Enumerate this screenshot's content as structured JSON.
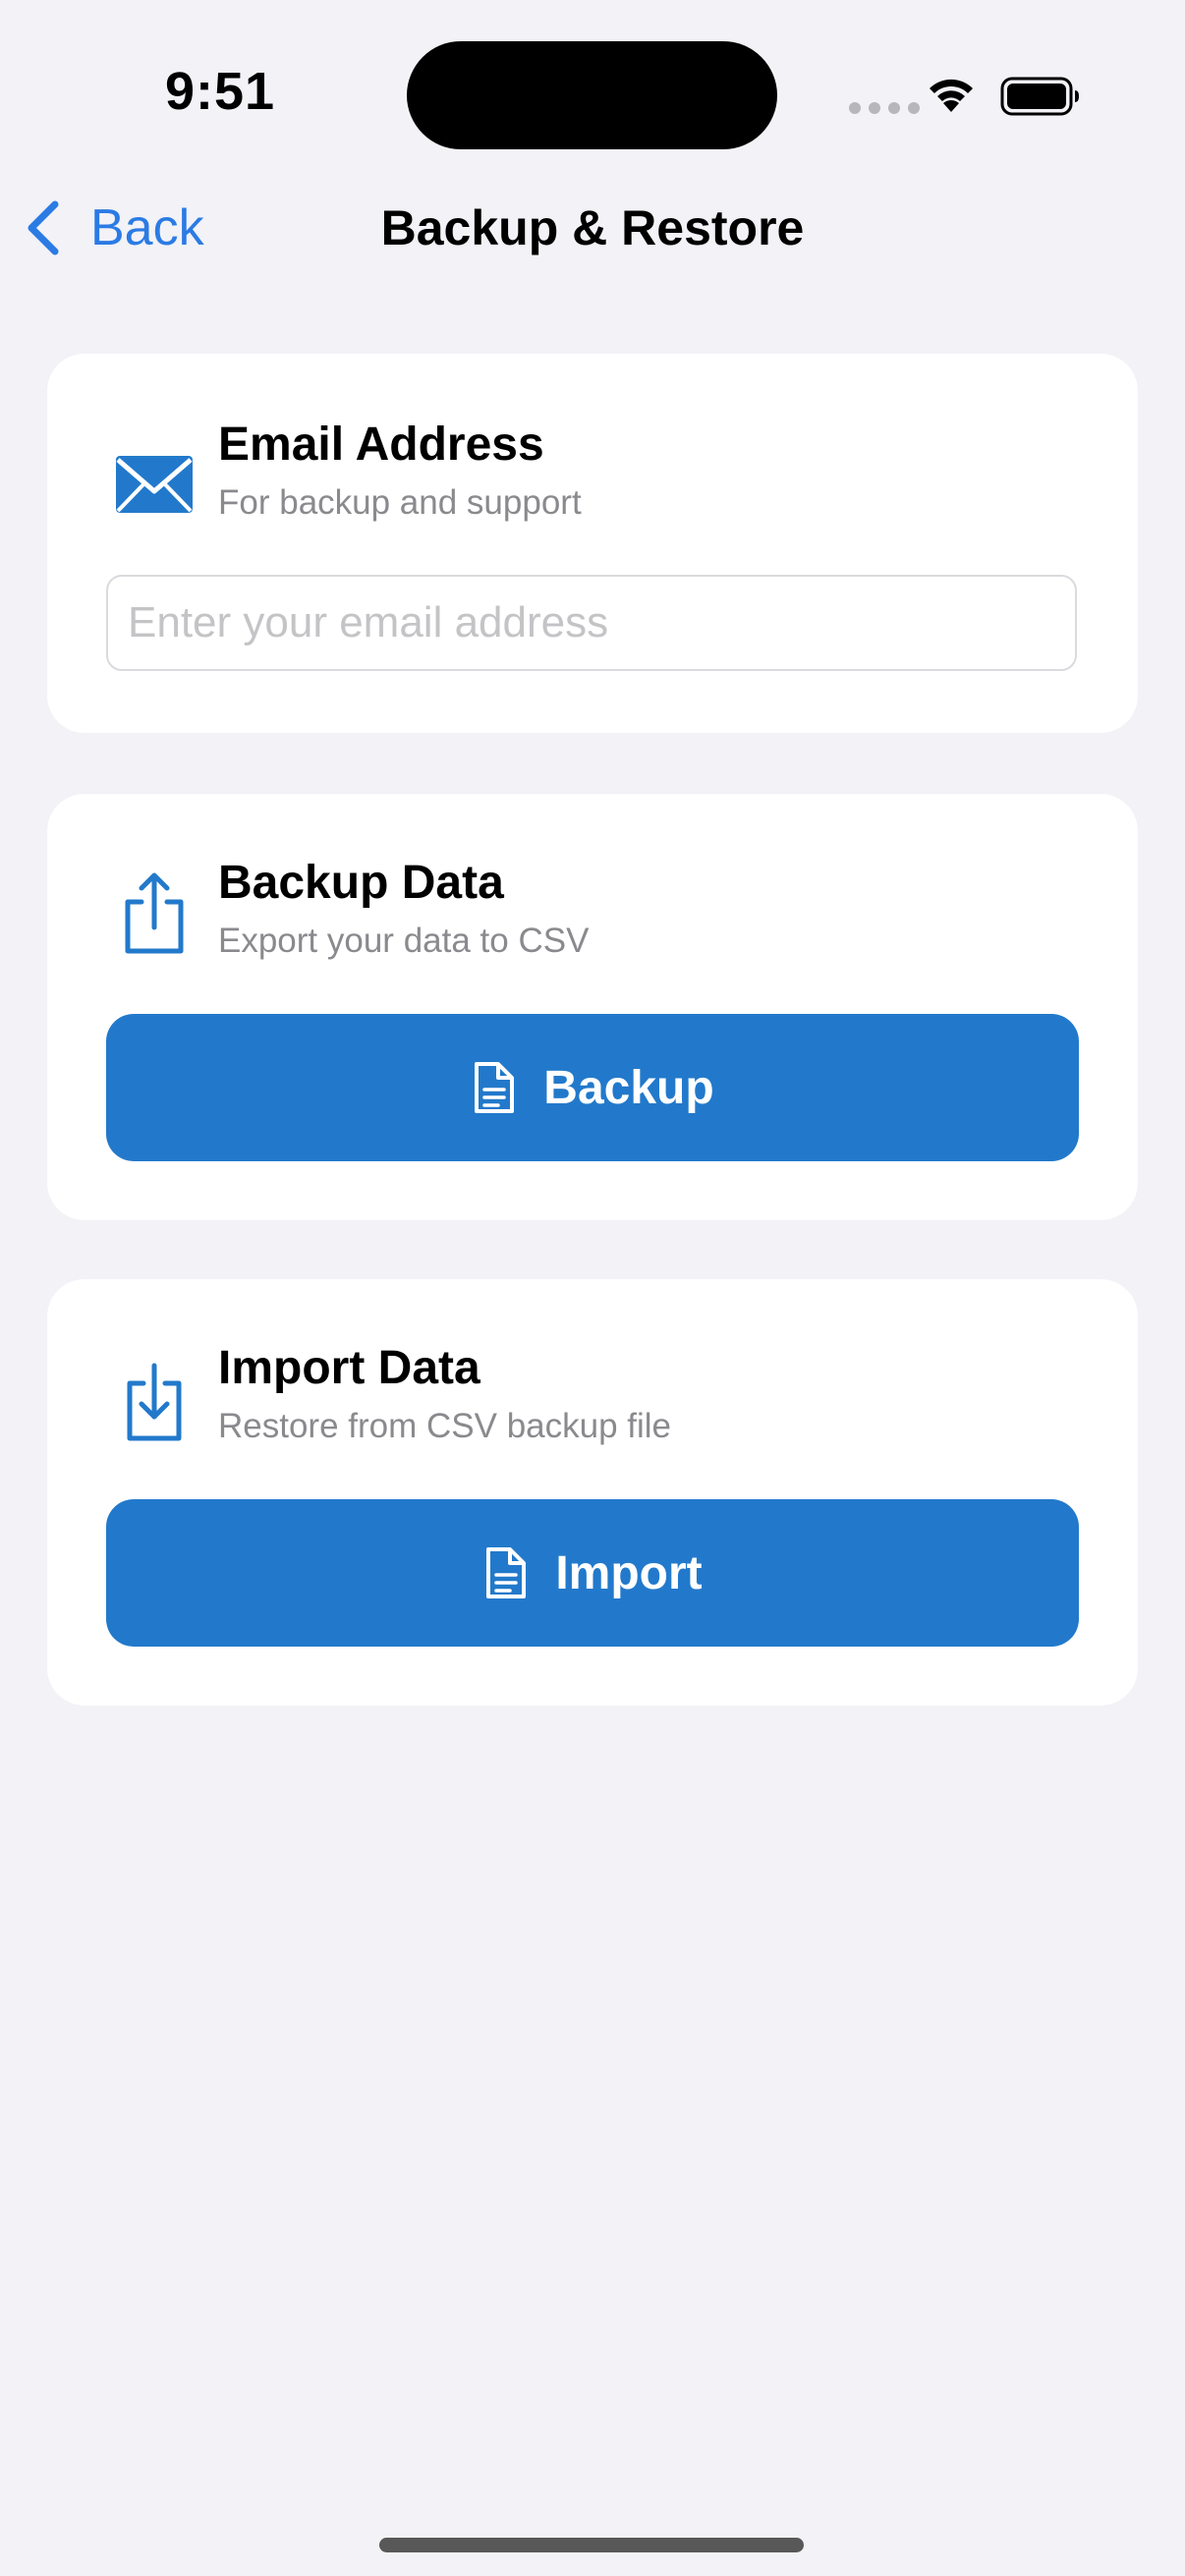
{
  "status_bar": {
    "time": "9:51"
  },
  "nav": {
    "back_label": "Back",
    "title": "Backup & Restore"
  },
  "email_card": {
    "title": "Email Address",
    "subtitle": "For backup and support",
    "input_placeholder": "Enter your email address",
    "input_value": "",
    "icon": "envelope-icon"
  },
  "backup_card": {
    "title": "Backup Data",
    "subtitle": "Export your data to CSV",
    "button_label": "Backup",
    "icon": "share-upload-icon"
  },
  "import_card": {
    "title": "Import Data",
    "subtitle": "Restore from CSV backup file",
    "button_label": "Import",
    "icon": "download-tray-icon"
  },
  "colors": {
    "accent": "#2279CB",
    "link": "#2B7BE4",
    "background": "#F2F2F7",
    "card": "#FFFFFF",
    "secondary_text": "#8A8A8E"
  }
}
